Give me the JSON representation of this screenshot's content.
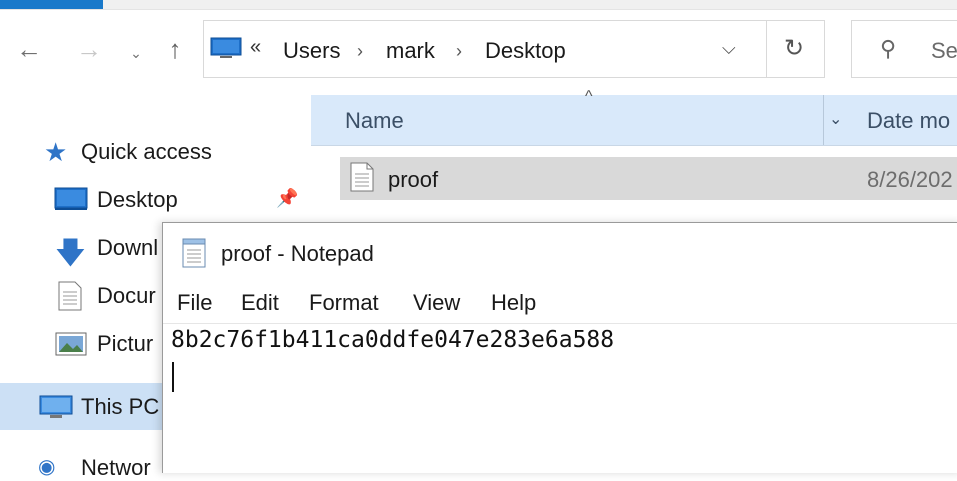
{
  "address_bar": {
    "overflow": "«",
    "crumbs": [
      "Users",
      "mark",
      "Desktop"
    ],
    "separator": "›"
  },
  "search": {
    "placeholder": "Se"
  },
  "nav_pane": {
    "quick_access": "Quick access",
    "desktop": "Desktop",
    "downloads": "Downl",
    "documents": "Docur",
    "pictures": "Pictur",
    "this_pc": "This PC",
    "network": "Networ"
  },
  "columns": {
    "name": "Name",
    "date": "Date mo"
  },
  "files": [
    {
      "name": "proof",
      "date": "8/26/202"
    }
  ],
  "notepad": {
    "title": "proof - Notepad",
    "menu": [
      "File",
      "Edit",
      "Format",
      "View",
      "Help"
    ],
    "content": "8b2c76f1b411ca0ddfe047e283e6a588"
  },
  "colors": {
    "accent": "#1979ca",
    "selection": "#cce0f5",
    "header_bg": "#d9e9fa",
    "row_selected": "#d9d9d9"
  },
  "icons": [
    "back-icon",
    "forward-icon",
    "recent-icon",
    "up-icon",
    "computer-icon",
    "refresh-icon",
    "search-icon",
    "star-icon",
    "pin-icon",
    "download-icon",
    "document-icon",
    "picture-icon",
    "network-icon",
    "text-file-icon",
    "notepad-icon"
  ]
}
